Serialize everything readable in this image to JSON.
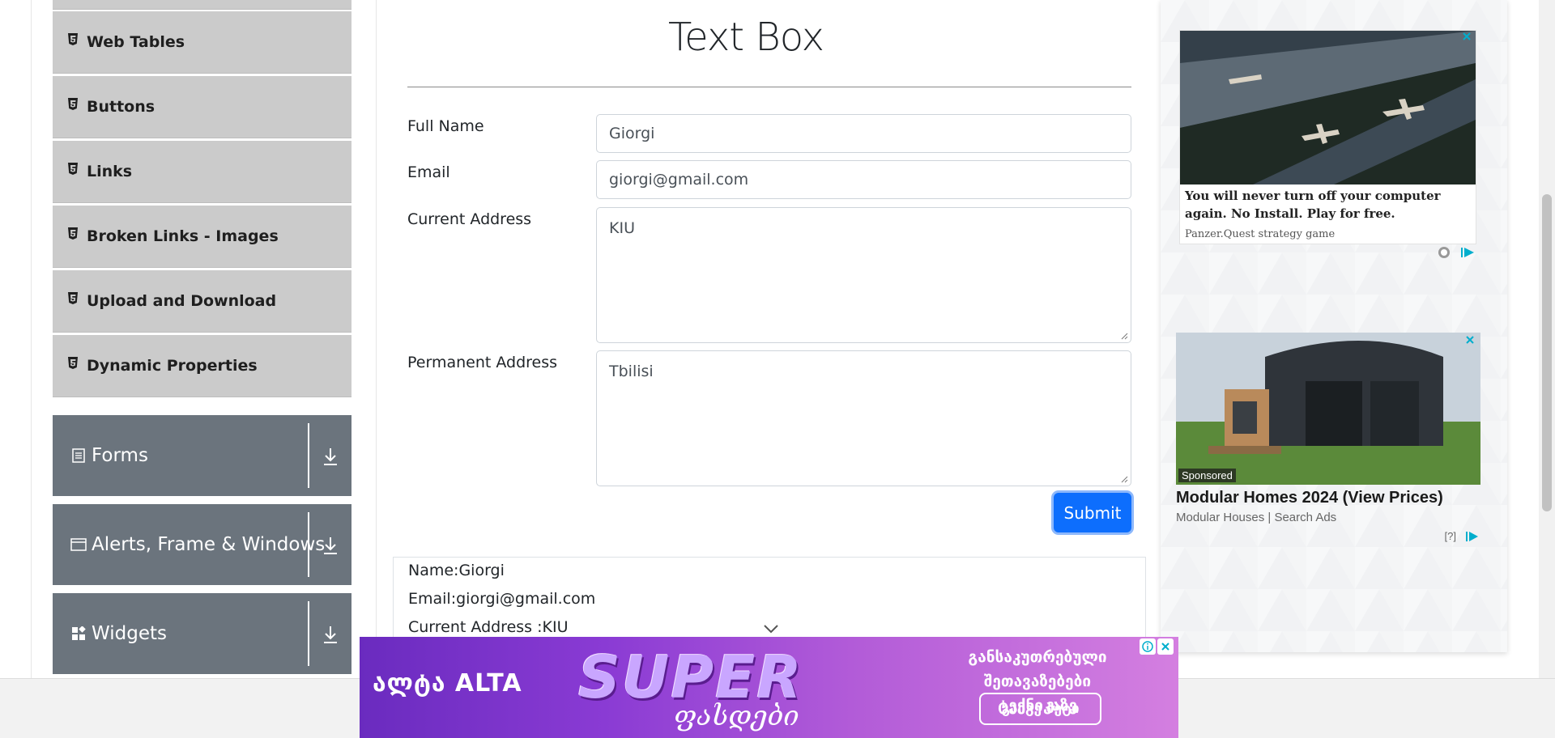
{
  "sidebar": {
    "elements_items": [
      {
        "label": "Web Tables"
      },
      {
        "label": "Buttons"
      },
      {
        "label": "Links"
      },
      {
        "label": "Broken Links - Images"
      },
      {
        "label": "Upload and Download"
      },
      {
        "label": "Dynamic Properties"
      }
    ],
    "groups": [
      {
        "label": "Forms",
        "icon": "form-icon"
      },
      {
        "label": "Alerts, Frame & Windows",
        "icon": "window-icon"
      },
      {
        "label": "Widgets",
        "icon": "widgets-icon"
      }
    ]
  },
  "form": {
    "title": "Text Box",
    "full_name_label": "Full Name",
    "full_name_value": "Giorgi",
    "email_label": "Email",
    "email_value": "giorgi@gmail.com",
    "current_address_label": "Current Address",
    "current_address_value": "KIU",
    "permanent_address_label": "Permanent Address",
    "permanent_address_value": "Tbilisi",
    "submit_label": "Submit"
  },
  "output": {
    "name": "Name:Giorgi",
    "email": "Email:giorgi@gmail.com",
    "current_address": "Current Address :KIU"
  },
  "ads": {
    "ad1": {
      "text": "You will never turn off your computer again. No Install. Play for free.",
      "source": "Panzer.Quest strategy game"
    },
    "ad2": {
      "badge": "Sponsored",
      "title": "Modular Homes 2024 (View Prices)",
      "source": "Modular Houses | Search Ads",
      "help": "[?]"
    }
  },
  "banner": {
    "brand": "ალტა ALTA",
    "headline": "SUPER",
    "script": "ფასდები",
    "text": "განსაკუთრებული შეთავაზებები ტექნიკაზე",
    "button": "გაიგე მეტი"
  },
  "colors": {
    "accent": "#0d6efd",
    "sidebar_item_bg": "#cbcbcb",
    "group_bg": "#6b747d"
  }
}
